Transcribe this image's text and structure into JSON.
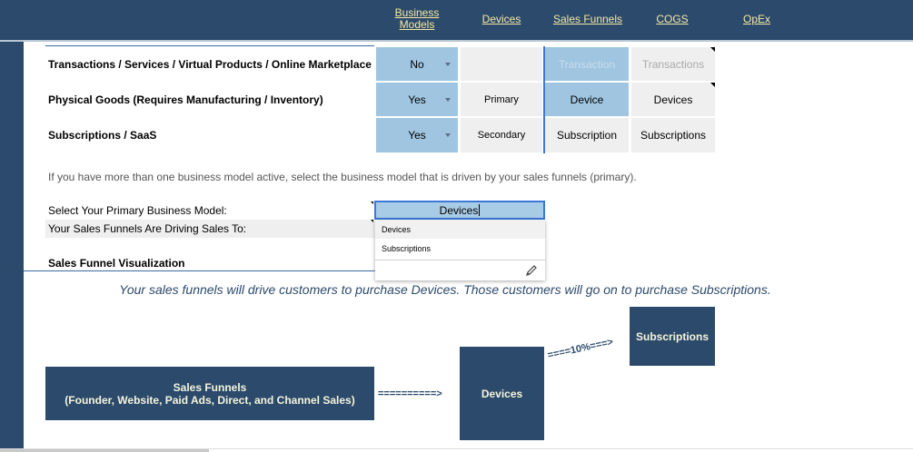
{
  "nav": {
    "business_models": "Business\nModels",
    "devices": "Devices",
    "sales_funnels": "Sales Funnels",
    "cogs": "COGS",
    "opex": "OpEx"
  },
  "rows": [
    {
      "label": "Transactions / Services / Virtual Products / Online Marketplace",
      "active": "No",
      "rank": "",
      "name": "Transaction",
      "plural": "Transactions"
    },
    {
      "label": "Physical Goods (Requires Manufacturing / Inventory)",
      "active": "Yes",
      "rank": "Primary",
      "name": "Device",
      "plural": "Devices"
    },
    {
      "label": "Subscriptions / SaaS",
      "active": "Yes",
      "rank": "Secondary",
      "name": "Subscription",
      "plural": "Subscriptions"
    }
  ],
  "note": "If you have more than one business model active, select the business model that is driven by your sales funnels (primary).",
  "select_primary_label": "Select Your Primary Business Model:",
  "driving_label": "Your Sales Funnels Are Driving Sales To:",
  "select_value": "Devices",
  "dropdown_options": [
    "Devices",
    "Subscriptions"
  ],
  "viz_title": "Sales Funnel Visualization",
  "funnel_sentence": "Your sales funnels will drive customers to purchase Devices.  Those customers will go on to purchase Subscriptions.",
  "diagram": {
    "funnels_line1": "Sales Funnels",
    "funnels_line2": "(Founder, Website, Paid Ads, Direct, and Channel Sales)",
    "arrow1": "==========>",
    "devices": "Devices",
    "arrow2": "====10%===>",
    "subscriptions": "Subscriptions"
  },
  "colors": {
    "navy": "#2c4a6b",
    "nav_link": "#f6e9a3",
    "light_blue": "#9fc5e0",
    "accent_blue": "#3c78d8"
  }
}
